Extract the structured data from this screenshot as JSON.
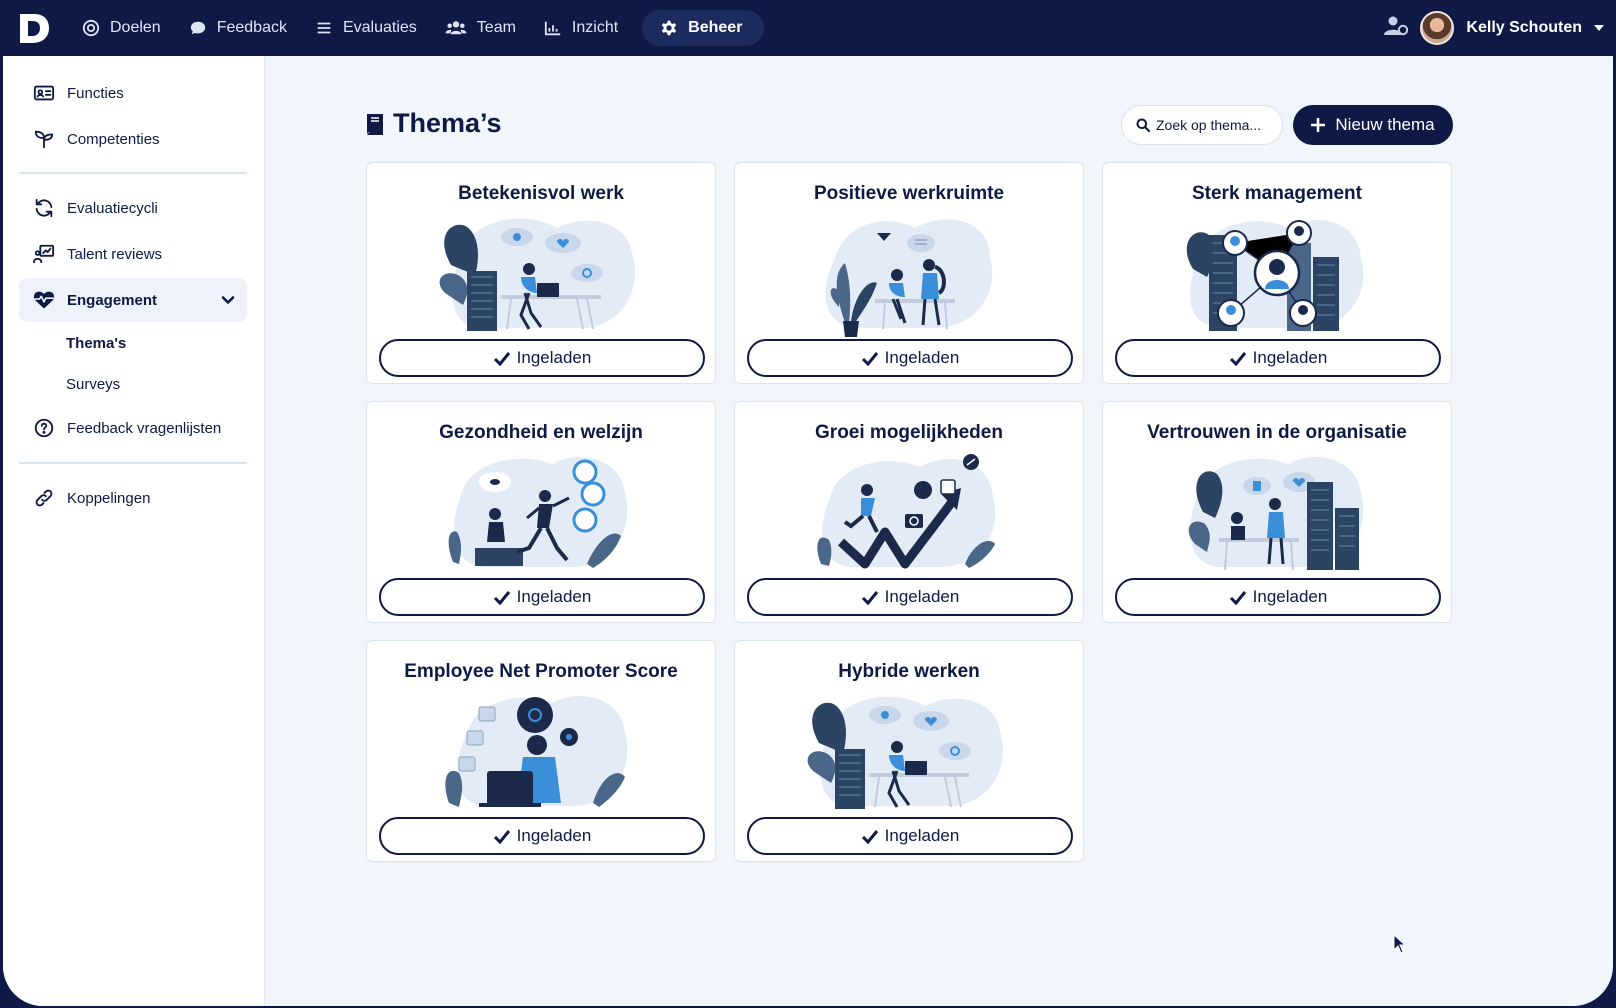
{
  "nav": {
    "items": [
      {
        "label": "Doelen",
        "icon": "target-icon"
      },
      {
        "label": "Feedback",
        "icon": "chat-icon"
      },
      {
        "label": "Evaluaties",
        "icon": "list-icon"
      },
      {
        "label": "Team",
        "icon": "users-icon"
      },
      {
        "label": "Inzicht",
        "icon": "chart-icon"
      },
      {
        "label": "Beheer",
        "icon": "gear-icon"
      }
    ],
    "active": "Beheer",
    "user_name": "Kelly Schouten"
  },
  "sidebar": {
    "items": [
      {
        "label": "Functies",
        "icon": "id-card-icon"
      },
      {
        "label": "Competenties",
        "icon": "sprout-icon"
      },
      {
        "label": "Evaluatiecycli",
        "icon": "refresh-icon"
      },
      {
        "label": "Talent reviews",
        "icon": "presentation-icon"
      },
      {
        "label": "Engagement",
        "icon": "heart-pulse-icon"
      },
      {
        "label": "Feedback vragenlijsten",
        "icon": "question-circle-icon"
      },
      {
        "label": "Koppelingen",
        "icon": "link-icon"
      }
    ],
    "sub_items": [
      "Thema's",
      "Surveys"
    ],
    "current": "Thema's"
  },
  "main": {
    "title": "Thema’s",
    "search_placeholder": "Zoek op thema...",
    "new_button": "Nieuw thema",
    "cards": [
      {
        "title": "Betekenisvol werk",
        "status": "Ingeladen"
      },
      {
        "title": "Positieve werkruimte",
        "status": "Ingeladen"
      },
      {
        "title": "Sterk management",
        "status": "Ingeladen"
      },
      {
        "title": "Gezondheid en welzijn",
        "status": "Ingeladen"
      },
      {
        "title": "Groei mogelijkheden",
        "status": "Ingeladen"
      },
      {
        "title": "Vertrouwen in de organisatie",
        "status": "Ingeladen"
      },
      {
        "title": "Employee Net Promoter Score",
        "status": "Ingeladen"
      },
      {
        "title": "Hybride werken",
        "status": "Ingeladen"
      }
    ]
  },
  "colors": {
    "navy": "#0e1a45",
    "background": "#f1f5fc",
    "illustration_blue": "#3b8fd9",
    "illustration_dark": "#2c4463"
  }
}
